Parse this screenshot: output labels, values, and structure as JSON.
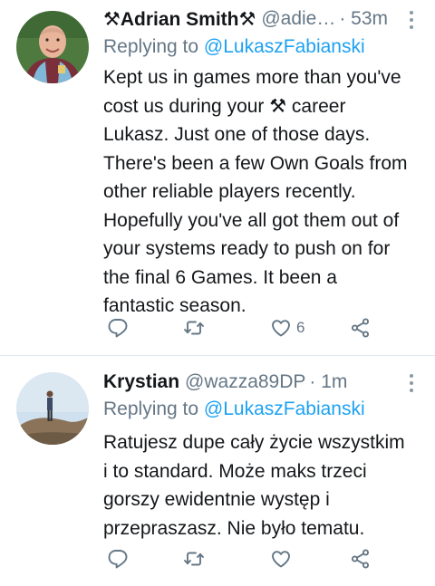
{
  "tweets": [
    {
      "author": "⚒Adrian Smith⚒",
      "handle": "@adie…",
      "time": "· 53m",
      "replying_label": "Replying to",
      "replying_to": "@LukaszFabianski",
      "lines": [
        "Kept us in games more than you've",
        "cost us during your ⚒ career",
        "Lukasz. Just one of those days.",
        "There's been a few Own Goals from",
        "other reliable players recently.",
        "Hopefully you've all got them out of",
        "your systems ready to push on for",
        "the final 6 Games. It been a",
        "fantastic season."
      ],
      "like_count": "6"
    },
    {
      "author": "Krystian",
      "handle": "@wazza89DP",
      "time": "· 1m",
      "replying_label": "Replying to",
      "replying_to": "@LukaszFabianski",
      "lines": [
        "Ratujesz dupe cały życie wszystkim",
        "i to standard. Może maks trzeci",
        "gorszy ewidentnie występ i",
        "przepraszasz. Nie było tematu."
      ],
      "like_count": ""
    }
  ],
  "colors": {
    "text": "#14171a",
    "secondary": "#657786",
    "link": "#1da1f2",
    "divider": "#e1e8ed"
  },
  "icons": [
    "more-vertical-icon",
    "reply-icon",
    "retweet-icon",
    "like-icon",
    "share-icon"
  ]
}
